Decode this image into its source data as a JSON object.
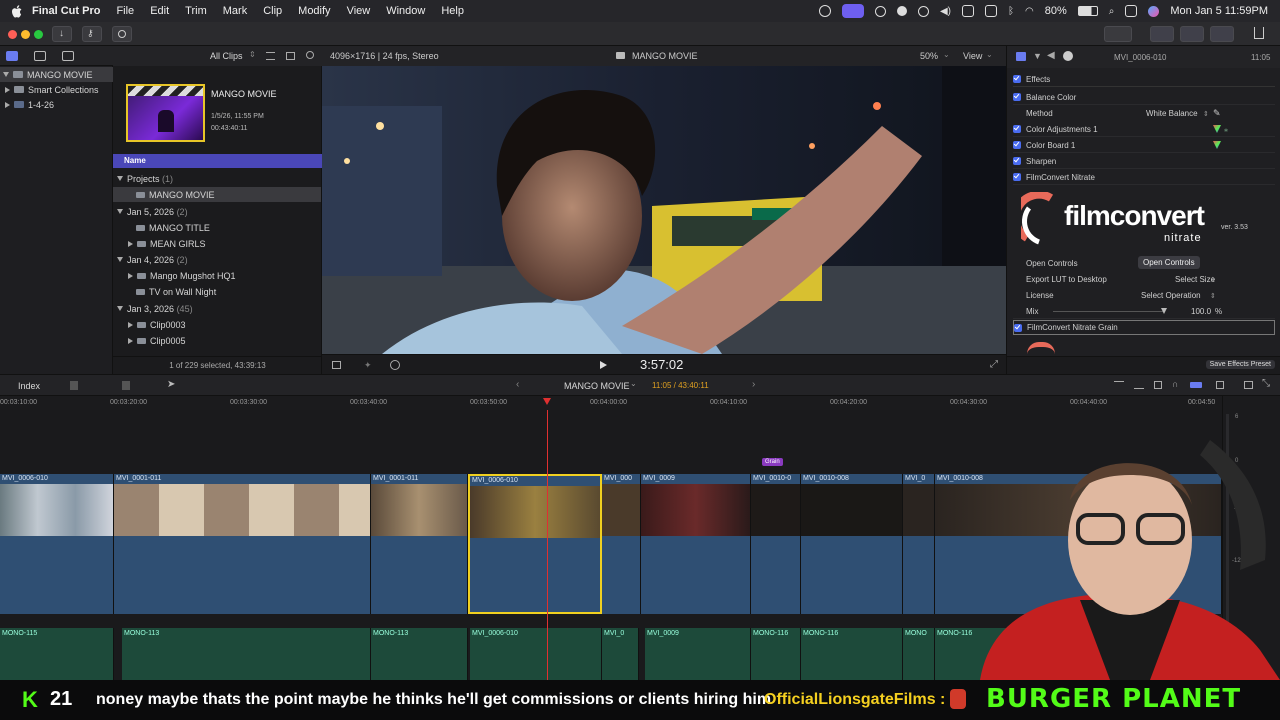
{
  "menubar": {
    "app": "Final Cut Pro",
    "items": [
      "File",
      "Edit",
      "Trim",
      "Mark",
      "Clip",
      "Modify",
      "View",
      "Window",
      "Help"
    ],
    "battery": "80%",
    "datetime": "Mon Jan 5  11:59PM"
  },
  "library": {
    "root": "MANGO MOVIE",
    "smart": "Smart Collections",
    "event": "1-4-26"
  },
  "browser": {
    "filter": "All Clips",
    "project_title": "MANGO MOVIE",
    "project_date": "1/5/26, 11:55 PM",
    "project_duration": "00:43:40:11",
    "name_header": "Name",
    "groups": [
      {
        "label": "Projects",
        "count": "(1)"
      },
      {
        "label": "Jan 5, 2026",
        "count": "(2)"
      },
      {
        "label": "Jan 4, 2026",
        "count": "(2)"
      },
      {
        "label": "Jan 3, 2026",
        "count": "(45)"
      }
    ],
    "items": {
      "p1": "MANGO MOVIE",
      "j5a": "MANGO TITLE",
      "j5b": "MEAN GIRLS",
      "j4a": "Mango Mugshot HQ1",
      "j4b": "TV on Wall Night",
      "j3a": "Clip0003",
      "j3b": "Clip0005"
    },
    "footer": "1 of 229 selected, 43:39:13"
  },
  "viewer": {
    "format": "4096×1716 | 24 fps, Stereo",
    "title": "MANGO MOVIE",
    "zoom": "50%",
    "view": "View",
    "timecode": "3:57:02"
  },
  "inspector": {
    "clip": "MVI_0006-010",
    "duration": "11:05",
    "effects": "Effects",
    "balance": "Balance Color",
    "method_label": "Method",
    "method_value": "White Balance",
    "adj": "Color Adjustments 1",
    "board": "Color Board 1",
    "sharpen": "Sharpen",
    "fc": "FilmConvert Nitrate",
    "logo_main": "filmconvert",
    "logo_sub": "nitrate",
    "version": "ver. 3.53",
    "open_controls_label": "Open Controls",
    "open_controls_btn": "Open Controls",
    "lut_label": "Export LUT to Desktop",
    "lut_value": "Select Size",
    "license_label": "License",
    "license_value": "Select Operation",
    "mix_label": "Mix",
    "mix_value": "100.0",
    "mix_unit": "%",
    "grain": "FilmConvert Nitrate Grain",
    "save_preset": "Save Effects Preset"
  },
  "timeline": {
    "index": "Index",
    "project": "MANGO MOVIE",
    "position": "11:05 / 43:40:11",
    "ruler": [
      "00:03:10:00",
      "00:03:20:00",
      "00:03:30:00",
      "00:03:40:00",
      "00:03:50:00",
      "00:04:00:00",
      "00:04:10:00",
      "00:04:20:00",
      "00:04:30:00",
      "00:04:40:00",
      "00:04:50"
    ],
    "grain_tag": "Grain",
    "clips": [
      "MVI_0006-010",
      "MVI_0001-011",
      "MVI_0001-011",
      "MVI_0006-010",
      "MVI_000",
      "MVI_0009",
      "MVI_0010-0",
      "MVI_0010-008",
      "MVI_0",
      "MVI_0010-008"
    ],
    "audio": [
      "MONO-115",
      "MONO-113",
      "MONO-113",
      "MVI_0006-010",
      "MVI_0",
      "MVI_0009",
      "MONO-116",
      "MONO-116",
      "MONO",
      "MONO-116"
    ],
    "meter": [
      "6",
      "0",
      "-6",
      "-12"
    ]
  },
  "ticker": {
    "badge": "21",
    "message": "noney maybe thats the point maybe he thinks he'll get commissions or clients hiring him",
    "user": "OfficialLionsgateFilms :",
    "brand": "BURGER PLANET"
  }
}
